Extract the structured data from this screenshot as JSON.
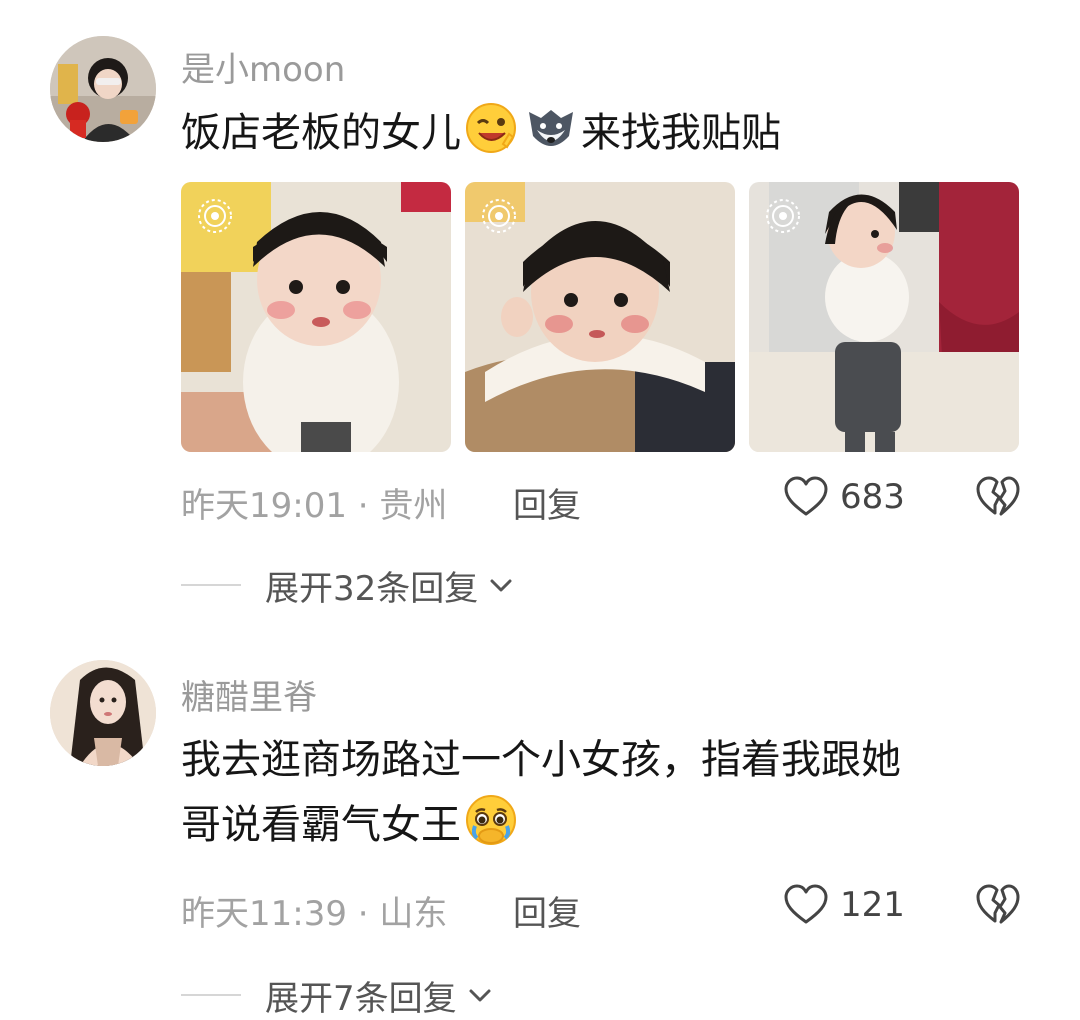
{
  "comments": [
    {
      "username": "是小moon",
      "text_before": "饭店老板的女儿",
      "text_after": "来找我贴贴",
      "emojis": [
        "winking-face-emoji",
        "wolf-face-emoji"
      ],
      "photos": [
        {
          "kind": "live-photo",
          "subject": "toddler in white sweater"
        },
        {
          "kind": "live-photo",
          "subject": "toddler leaning on couch"
        },
        {
          "kind": "live-photo",
          "subject": "toddler standing by table"
        }
      ],
      "time": "昨天19:01",
      "separator": " · ",
      "location": "贵州",
      "reply_label": "回复",
      "likes": "683",
      "expand_label": "展开32条回复"
    },
    {
      "username": "糖醋里脊",
      "text_line1": "我去逛商场路过一个小女孩，指着我跟她",
      "text_line2": "哥说看霸气女王",
      "emojis": [
        "holding-back-tears-emoji"
      ],
      "time": "昨天11:39",
      "separator": " · ",
      "location": "山东",
      "reply_label": "回复",
      "likes": "121",
      "expand_label": "展开7条回复"
    }
  ],
  "icons": {
    "like": "heart-outline-icon",
    "dislike": "broken-heart-icon",
    "expand": "chevron-down-icon",
    "live_photo": "live-photo-icon"
  },
  "colors": {
    "username": "#9a9a9a",
    "meta": "#a2a2a2",
    "text": "#161616"
  }
}
